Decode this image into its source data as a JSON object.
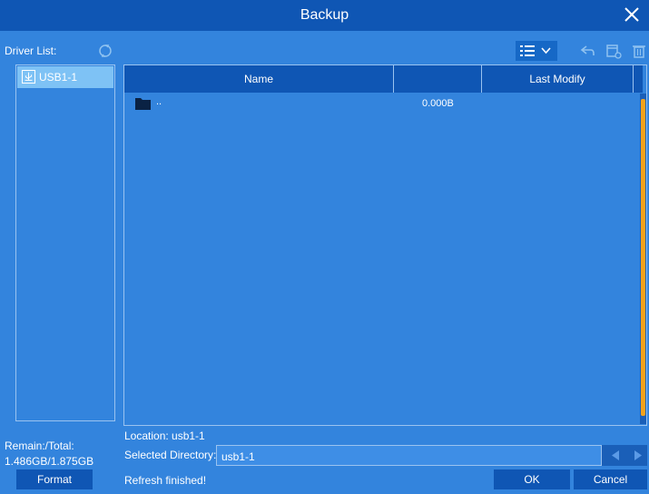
{
  "window": {
    "title": "Backup"
  },
  "sidebar": {
    "driver_list_label": "Driver List:",
    "drivers": [
      {
        "label": "USB1-1"
      }
    ],
    "remain_total_label": "Remain:/Total:",
    "remain_total_value": "1.486GB/1.875GB",
    "format_label": "Format"
  },
  "toolbar": {
    "icons": [
      "list-view-icon",
      "chevron-down-icon",
      "back-icon",
      "new-folder-icon",
      "delete-icon"
    ]
  },
  "file_table": {
    "columns": [
      "Name",
      "",
      "Last Modify"
    ],
    "rows": [
      {
        "name": "..",
        "size": "0.000B",
        "modified": ""
      }
    ]
  },
  "footer": {
    "location": "Location: usb1-1",
    "selected_directory_label": "Selected Directory:",
    "selected_directory_value": "usb1-1",
    "status": "Refresh finished!",
    "ok_label": "OK",
    "cancel_label": "Cancel"
  },
  "colors": {
    "background": "#3384dd",
    "titlebar": "#0f56b4",
    "selected": "#7ec2f5",
    "scroll_thumb": "#f5a21b"
  }
}
